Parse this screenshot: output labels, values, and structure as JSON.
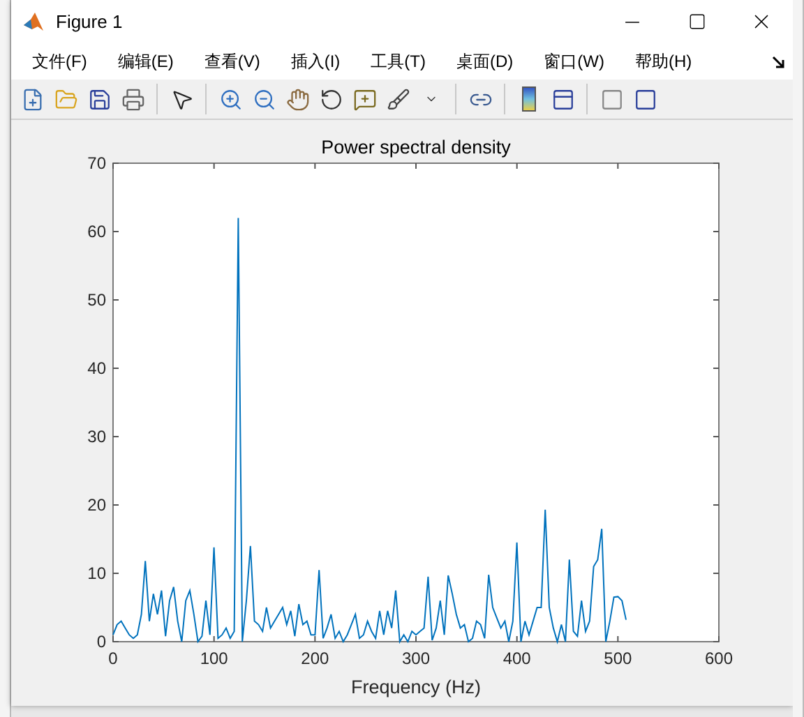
{
  "window": {
    "title": "Figure 1"
  },
  "menu": [
    "文件(F)",
    "编辑(E)",
    "查看(V)",
    "插入(I)",
    "工具(T)",
    "桌面(D)",
    "窗口(W)",
    "帮助(H)"
  ],
  "chart_data": {
    "type": "line",
    "title": "Power spectral density",
    "xlabel": "Frequency (Hz)",
    "xlim": [
      0,
      600
    ],
    "ylim": [
      0,
      70
    ],
    "xticks": [
      0,
      100,
      200,
      300,
      400,
      500,
      600
    ],
    "yticks": [
      0,
      10,
      20,
      30,
      40,
      50,
      60,
      70
    ],
    "x": [
      0,
      4,
      8,
      12,
      16,
      20,
      24,
      28,
      32,
      36,
      40,
      44,
      48,
      52,
      56,
      60,
      64,
      68,
      72,
      76,
      80,
      84,
      88,
      92,
      96,
      100,
      104,
      108,
      112,
      116,
      120,
      124,
      128,
      132,
      136,
      140,
      144,
      148,
      152,
      156,
      160,
      164,
      168,
      172,
      176,
      180,
      184,
      188,
      192,
      196,
      200,
      204,
      208,
      212,
      216,
      220,
      224,
      228,
      232,
      236,
      240,
      244,
      248,
      252,
      256,
      260,
      264,
      268,
      272,
      276,
      280,
      284,
      288,
      292,
      296,
      300,
      304,
      308,
      312,
      316,
      320,
      324,
      328,
      332,
      336,
      340,
      344,
      348,
      352,
      356,
      360,
      364,
      368,
      372,
      376,
      380,
      384,
      388,
      392,
      396,
      400,
      404,
      408,
      412,
      416,
      420,
      424,
      428,
      432,
      436,
      440,
      444,
      448,
      452,
      456,
      460,
      464,
      468,
      472,
      476,
      480,
      484,
      488,
      492,
      496,
      500,
      504,
      508
    ],
    "series": [
      {
        "color": "#0072bd",
        "values": [
          1,
          2.5,
          3,
          2,
          1,
          0.5,
          1,
          4,
          11.8,
          3,
          7,
          4,
          7.5,
          0.8,
          6,
          8,
          3,
          0,
          6,
          7.5,
          4,
          0,
          0.8,
          6,
          1,
          13.8,
          0.5,
          1,
          2,
          0.5,
          1.5,
          62,
          0,
          6,
          14,
          3,
          2.5,
          1.5,
          5,
          2,
          3,
          4,
          5,
          2.5,
          4.5,
          0.8,
          5.5,
          2.5,
          3,
          1,
          1,
          10.5,
          0.5,
          2,
          4,
          0.5,
          1.5,
          0,
          1,
          2.5,
          4,
          0.5,
          1,
          3,
          1.5,
          0.5,
          4.5,
          1,
          4.5,
          2,
          7.5,
          0,
          1,
          0,
          1.5,
          1,
          1.5,
          2,
          9.5,
          0.2,
          2,
          6,
          1,
          9.7,
          7,
          4,
          2,
          2.5,
          0,
          0.5,
          3,
          2.5,
          0.5,
          9.8,
          5,
          3.5,
          2,
          3,
          0,
          3,
          14.5,
          0,
          3,
          1,
          3,
          5,
          5,
          19.3,
          5,
          2,
          0,
          2.5,
          0,
          12,
          1.5,
          0.8,
          6,
          1.5,
          3,
          11,
          12,
          16.5,
          0,
          3,
          6.5,
          6.6,
          6,
          3.2
        ]
      }
    ]
  }
}
